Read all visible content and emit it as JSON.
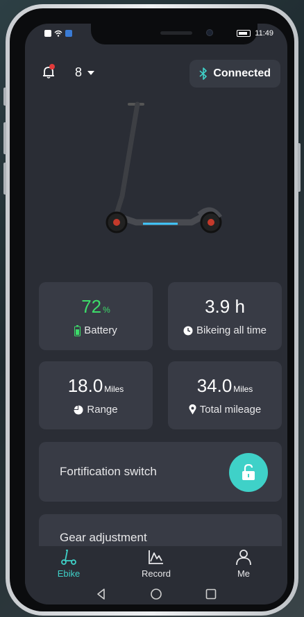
{
  "status_bar": {
    "time": "11:49"
  },
  "header": {
    "device_number": "8",
    "connection_status": "Connected"
  },
  "stats": {
    "battery": {
      "value": "72",
      "unit": "%",
      "label": "Battery"
    },
    "bike_time": {
      "value": "3.9 h",
      "label": "Bikeing all time"
    },
    "range": {
      "value": "18.0",
      "unit": "Miles",
      "label": "Range"
    },
    "total_mileage": {
      "value": "34.0",
      "unit": "Miles",
      "label": "Total mileage"
    }
  },
  "controls": {
    "fortification_label": "Fortification switch",
    "gear_label": "Gear adjustment"
  },
  "bottom_nav": {
    "items": [
      {
        "label": "Ebike",
        "icon": "scooter-icon",
        "active": true
      },
      {
        "label": "Record",
        "icon": "chart-icon",
        "active": false
      },
      {
        "label": "Me",
        "icon": "person-icon",
        "active": false
      }
    ]
  },
  "colors": {
    "accent": "#3fd1c8",
    "battery_green": "#3ddc6a",
    "card_bg": "#383b45",
    "screen_bg": "#2a2d35",
    "notification_dot": "#e23b3b"
  }
}
